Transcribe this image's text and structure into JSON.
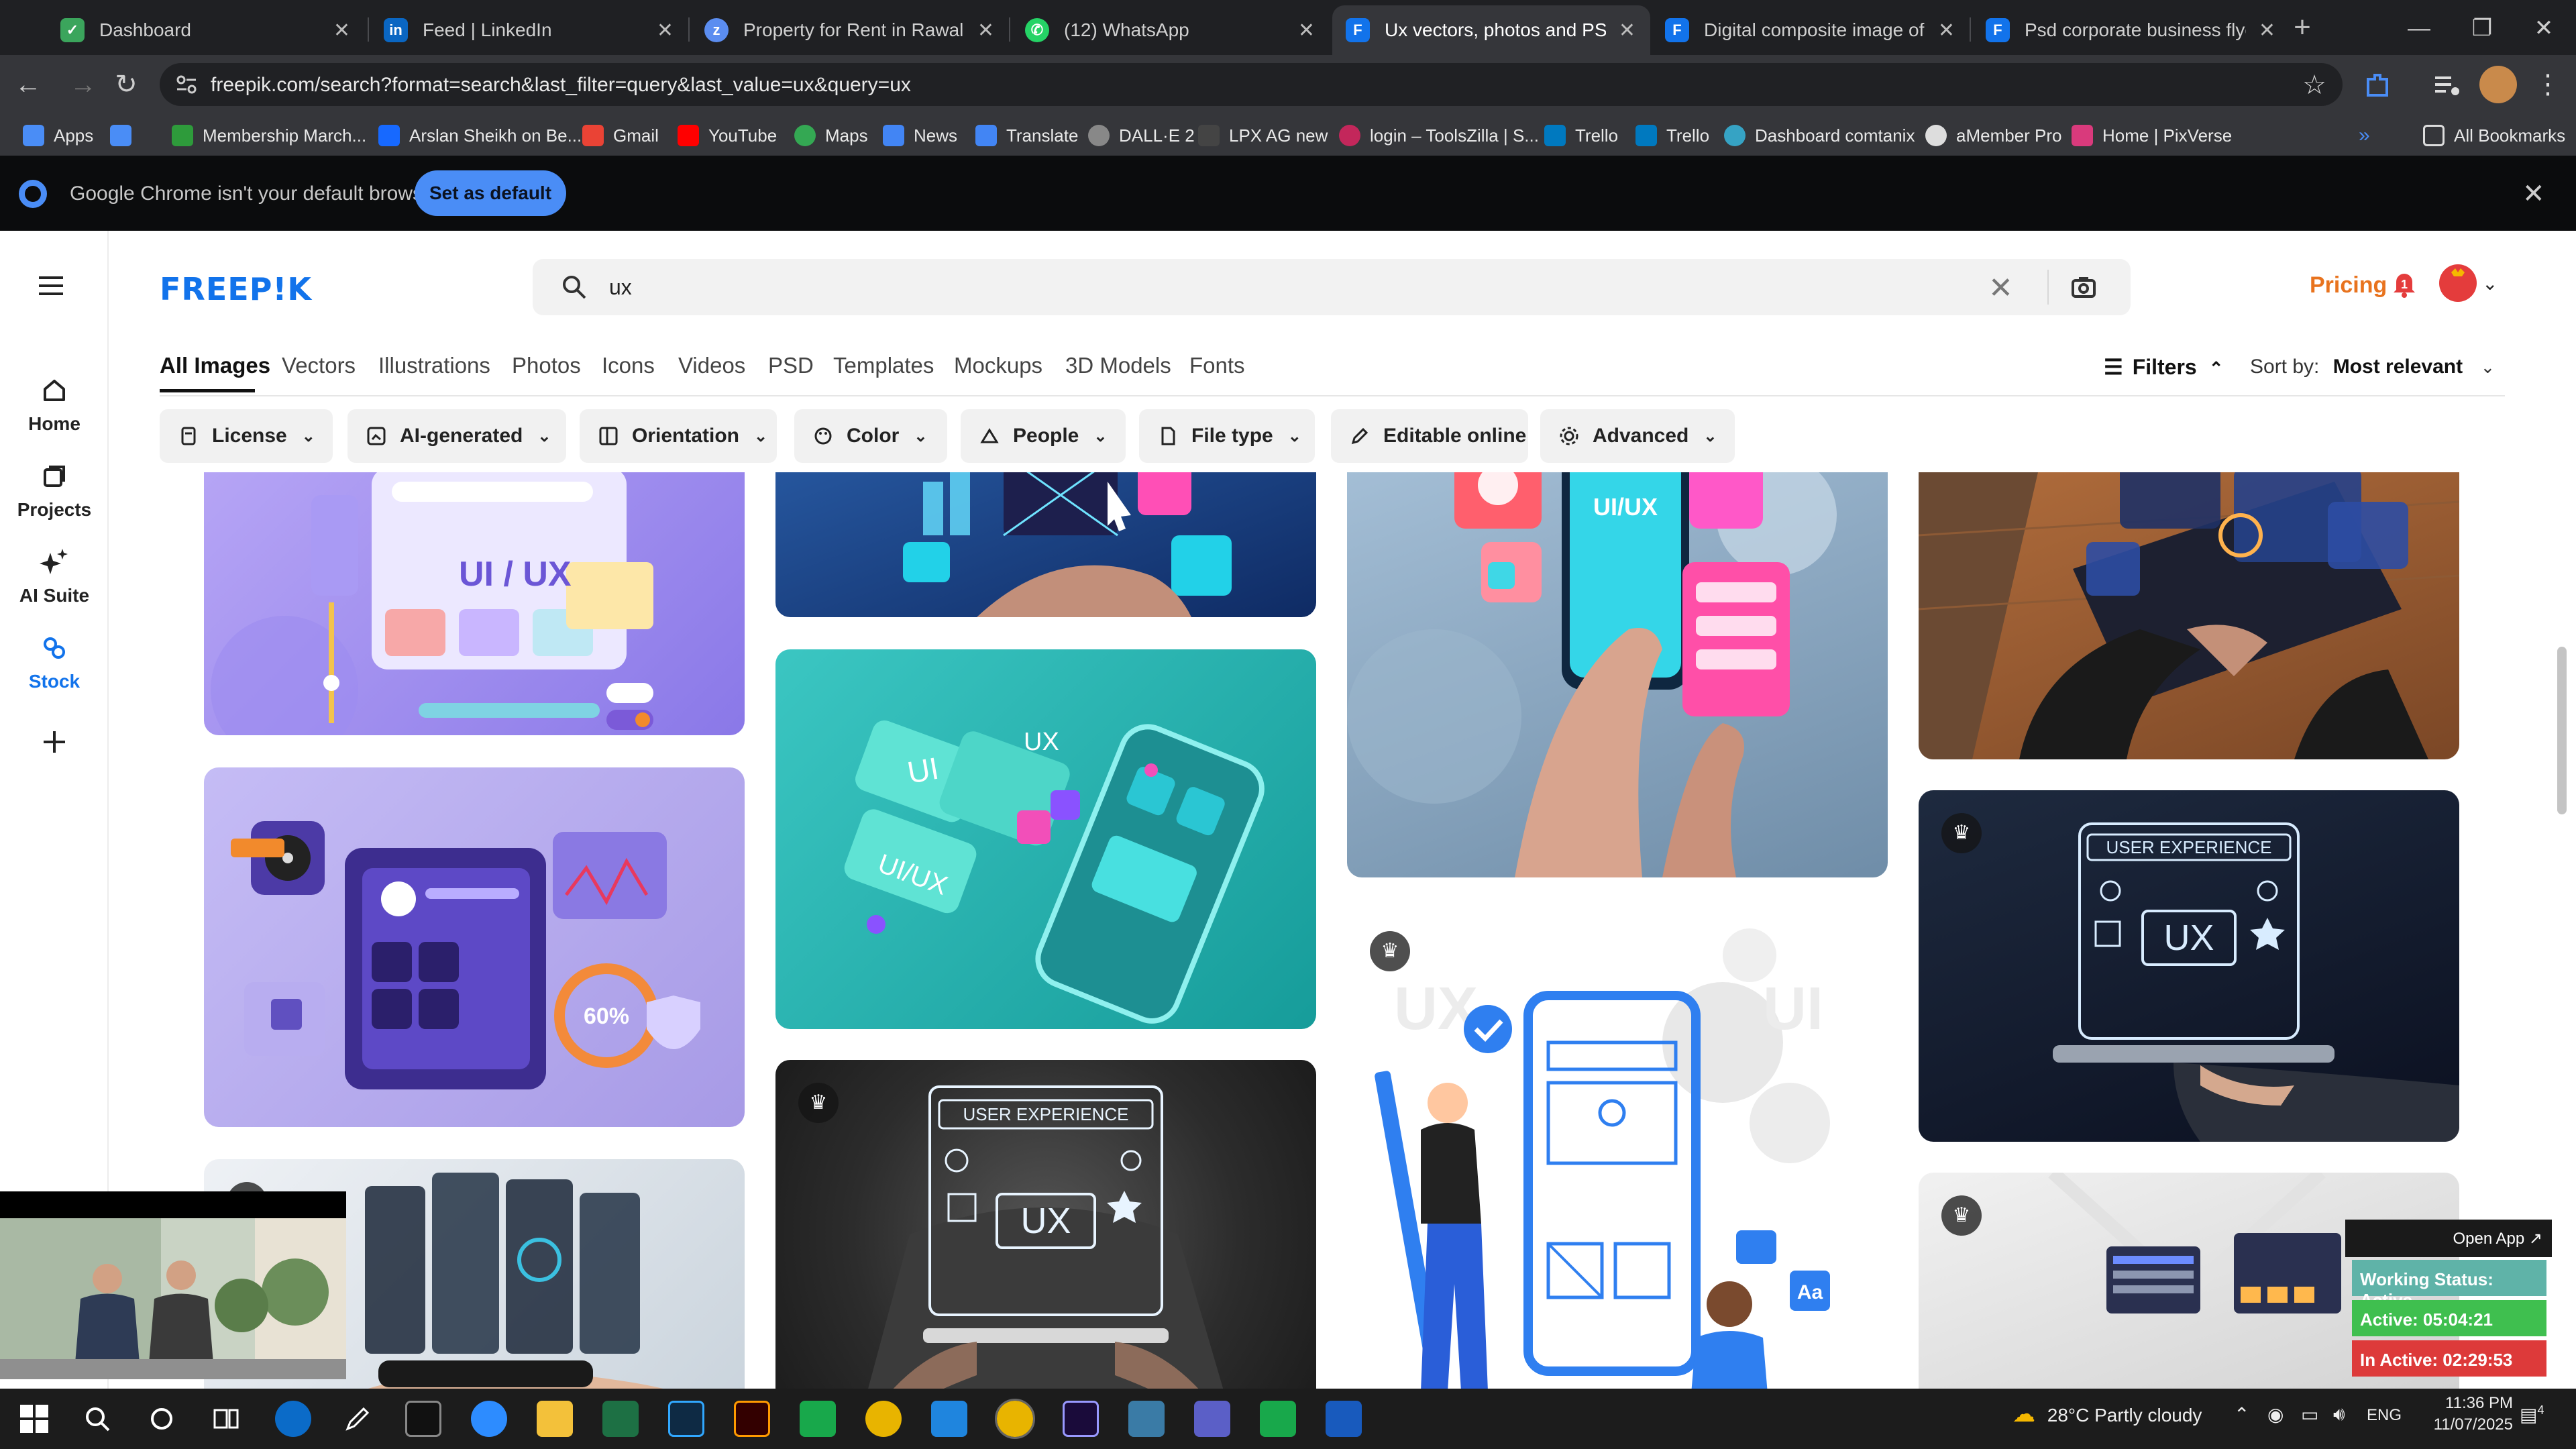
{
  "browser": {
    "tabs": [
      {
        "title": "Dashboard",
        "icon": "dashboard-icon",
        "color": "#3ba55c"
      },
      {
        "title": "Feed | LinkedIn",
        "icon": "linkedin-icon",
        "color": "#0a66c2"
      },
      {
        "title": "Property for Rent in Rawalpindi",
        "icon": "zameen-icon",
        "color": "#5b8df0"
      },
      {
        "title": "(12) WhatsApp",
        "icon": "whatsapp-icon",
        "color": "#25d366"
      },
      {
        "title": "Ux vectors, photos and PSD files",
        "icon": "freepik-icon",
        "color": "#1273eb"
      },
      {
        "title": "Digital composite image of graphs",
        "icon": "freepik-icon",
        "color": "#1273eb"
      },
      {
        "title": "Psd corporate business flyer design",
        "icon": "freepik-icon",
        "color": "#1273eb"
      }
    ],
    "active_tab": 4,
    "url": "freepik.com/search?format=search&last_filter=query&last_value=ux&query=ux",
    "bookmarks": [
      {
        "label": "Apps",
        "color": "#4a8df6"
      },
      {
        "label": "",
        "color": "#4a8df6"
      },
      {
        "label": "Membership March...",
        "color": "#2e9b3b"
      },
      {
        "label": "Arslan Sheikh on Be...",
        "color": "#1769ff"
      },
      {
        "label": "Gmail",
        "color": "#ea4335"
      },
      {
        "label": "YouTube",
        "color": "#ff0000"
      },
      {
        "label": "Maps",
        "color": "#34a853"
      },
      {
        "label": "News",
        "color": "#4285f4"
      },
      {
        "label": "Translate",
        "color": "#4285f4"
      },
      {
        "label": "DALL·E 2",
        "color": "#888888"
      },
      {
        "label": "LPX AG new",
        "color": "#444444"
      },
      {
        "label": "login – ToolsZilla | S...",
        "color": "#c3275b"
      },
      {
        "label": "Trello",
        "color": "#0079bf"
      },
      {
        "label": "Trello",
        "color": "#0079bf"
      },
      {
        "label": "Dashboard comtanix",
        "color": "#36a3c4"
      },
      {
        "label": "aMember Pro",
        "color": "#dddddd"
      },
      {
        "label": "Home | PixVerse",
        "color": "#d93a7c"
      }
    ],
    "all_bookmarks": "All Bookmarks",
    "default_banner": {
      "message": "Google Chrome isn't your default browser",
      "button": "Set as default"
    }
  },
  "freepik": {
    "logo": "FREEP!K",
    "sidebar": [
      {
        "label": "Home",
        "icon": "home-icon"
      },
      {
        "label": "Projects",
        "icon": "projects-icon"
      },
      {
        "label": "AI Suite",
        "icon": "ai-suite-icon"
      },
      {
        "label": "Stock",
        "icon": "stock-icon"
      },
      {
        "label": "",
        "icon": "plus-icon"
      }
    ],
    "search": {
      "query": "ux"
    },
    "pricing": "Pricing",
    "notifications": "1",
    "content_tabs": [
      "All Images",
      "Vectors",
      "Illustrations",
      "Photos",
      "Icons",
      "Videos",
      "PSD",
      "Templates",
      "Mockups",
      "3D Models",
      "Fonts"
    ],
    "filters_label": "Filters",
    "sort_label": "Sort by:",
    "sort_value": "Most relevant",
    "filter_chips": [
      {
        "label": "License",
        "icon": "license-icon"
      },
      {
        "label": "AI-generated",
        "icon": "ai-generated-icon"
      },
      {
        "label": "Orientation",
        "icon": "orientation-icon"
      },
      {
        "label": "Color",
        "icon": "color-icon"
      },
      {
        "label": "People",
        "icon": "people-icon"
      },
      {
        "label": "File type",
        "icon": "file-type-icon"
      },
      {
        "label": "Editable online",
        "icon": "edit-icon"
      },
      {
        "label": "Advanced",
        "icon": "advanced-icon"
      }
    ],
    "image_text": {
      "uiux": "UI / UX",
      "ui": "UI",
      "ux": "UX",
      "uiux2": "UI/UX",
      "phone_uiux": "UI/UX",
      "user_experience": "USER EXPERIENCE",
      "percent": "60%",
      "aa": "Aa"
    }
  },
  "overlay": {
    "open_app": "Open App ↗",
    "working_status": "Working Status: Active",
    "active": "Active: 05:04:21",
    "inactive": "In Active: 02:29:53"
  },
  "taskbar": {
    "weather": "28°C  Partly cloudy",
    "lang": "ENG",
    "time": "11:36 PM",
    "date": "11/07/2025",
    "notif_count": "4"
  }
}
